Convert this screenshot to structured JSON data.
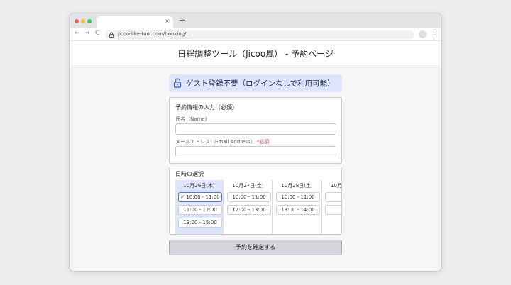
{
  "browser": {
    "tab_close": "×",
    "new_tab": "+",
    "nav_back": "←",
    "nav_forward": "→",
    "nav_reload": "C",
    "url": "jicoo-like-tool.com/booking/...",
    "menu_icon": "⋮"
  },
  "page": {
    "title": "日程調整ツール（Jicoo風） - 予約ページ"
  },
  "guest_banner": {
    "label": "ゲスト登録不要（ログインなしで利用可能）",
    "icon": "unlock-icon"
  },
  "form": {
    "title": "予約情報の入力（必須）",
    "name_label": "氏名（Name）",
    "email_label": "メールアドレス（Email Address）",
    "required_mark": "*必須",
    "name_value": "",
    "email_value": ""
  },
  "datetime": {
    "title": "日時の選択",
    "columns": [
      {
        "date": "10月26日(木)",
        "selected": true,
        "slots": [
          "✓ 10:00 - 11:00",
          "11:00 - 12:00",
          "13:00 - 15:00"
        ]
      },
      {
        "date": "10月27日(金)",
        "slots": [
          "10:00 - 11:00",
          "12:00 - 13:00"
        ]
      },
      {
        "date": "10月28日(土)",
        "slots": [
          "10:00 - 11:00",
          "13:00 - 14:00"
        ]
      },
      {
        "date": "10月",
        "slots": [
          "",
          ""
        ]
      }
    ]
  },
  "submit_label": "予約を確定する",
  "colors": {
    "accent_bg": "#dce5fb",
    "required": "#d33a6a",
    "button_bg": "#d4d5db"
  }
}
